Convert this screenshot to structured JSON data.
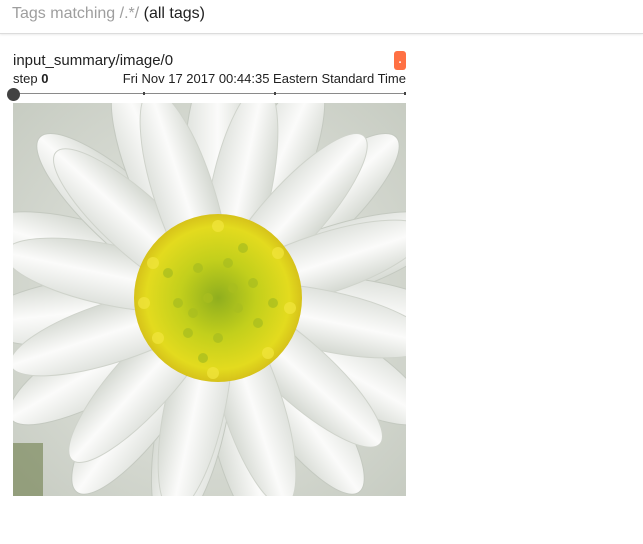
{
  "header": {
    "prefix": "Tags matching",
    "regex": "/.*/",
    "suffix": "(all tags)"
  },
  "card": {
    "title": "input_summary/image/0",
    "badge": ".",
    "badge_color": "#ff7043",
    "step_label": "step",
    "step_value": "0",
    "timestamp": "Fri Nov 17 2017 00:44:35 Eastern Standard Time",
    "slider": {
      "value": 0,
      "ticks": 3
    },
    "image": {
      "subject": "white daisy flower with yellow center",
      "icon": "flower-image"
    }
  }
}
